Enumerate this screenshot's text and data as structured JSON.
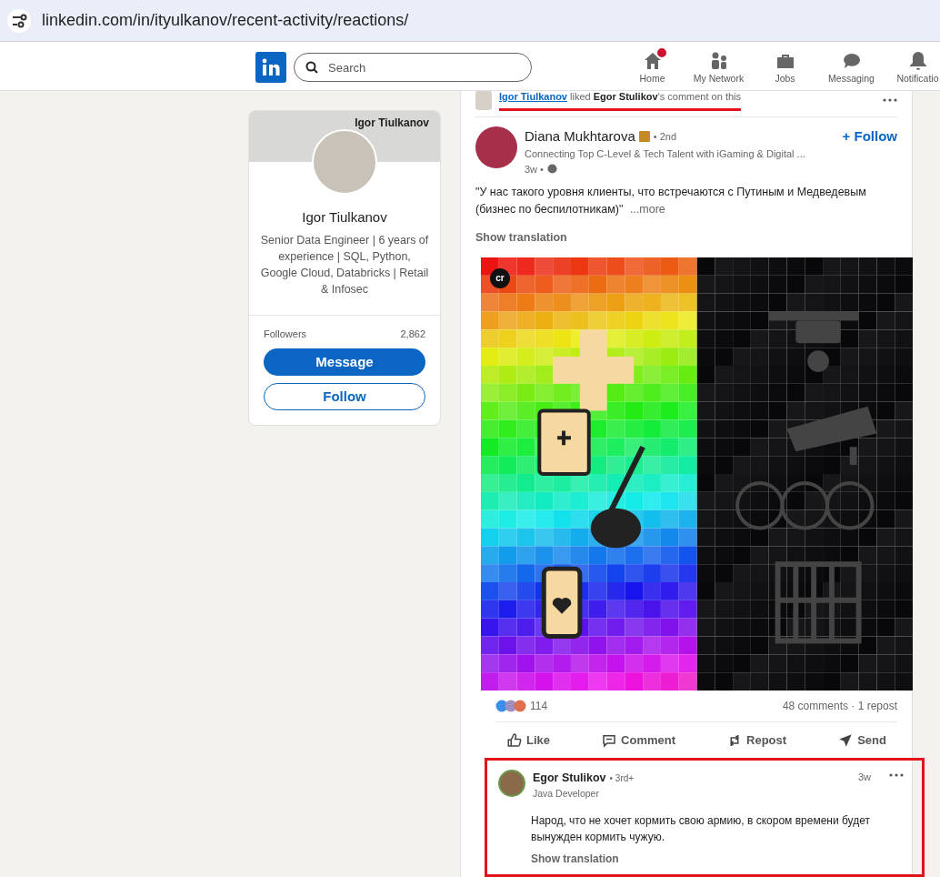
{
  "address_bar": {
    "url": "linkedin.com/in/ityulkanov/recent-activity/reactions/"
  },
  "nav": {
    "search_placeholder": "Search",
    "items": [
      {
        "label": "Home",
        "kind": "home",
        "badge": true
      },
      {
        "label": "My Network",
        "kind": "network",
        "badge": false
      },
      {
        "label": "Jobs",
        "kind": "jobs",
        "badge": false
      },
      {
        "label": "Messaging",
        "kind": "messaging",
        "badge": false
      },
      {
        "label": "Notificatio",
        "kind": "bell",
        "badge": false
      }
    ]
  },
  "profile_card": {
    "banner_title": "Igor Tiulkanov",
    "name": "Igor Tiulkanov",
    "headline": "Senior Data Engineer | 6 years of experience | SQL, Python, Google Cloud, Databricks | Retail & Infosec",
    "stat_label": "Followers",
    "stat_value": "2,862",
    "buttons": [
      {
        "label": "Message",
        "kind": "primary"
      },
      {
        "label": "Follow",
        "kind": "outline"
      }
    ]
  },
  "activity": {
    "actor": "Igor Tiulkanov",
    "verb": "liked",
    "target": "Egor Stulikov",
    "suffix": "'s comment on this",
    "underlined": true
  },
  "post": {
    "author": "Diana Mukhtarova",
    "degree": "• 2nd",
    "subtitle": "Connecting Top C-Level & Tech Talent with iGaming & Digital ...",
    "age": "3w •",
    "follow": "+ Follow",
    "text": "\"У нас такого уровня клиенты, что встречаются с Путиным и Медведевым (бизнес по беспилотникам)\"",
    "more": "...more",
    "translation": "Show translation",
    "image_badge": "cr",
    "reactions_count": "114",
    "stats": "48 comments · 1 repost",
    "actions": [
      {
        "label": "Like",
        "kind": "like"
      },
      {
        "label": "Comment",
        "kind": "comment"
      },
      {
        "label": "Repost",
        "kind": "repost"
      },
      {
        "label": "Send",
        "kind": "send"
      }
    ]
  },
  "comment": {
    "author": "Egor Stulikov",
    "degree": "• 3rd+",
    "headline": "Java Developer",
    "age": "3w",
    "text": "Народ, что не хочет кормить свою армию, в скором времени будет вынужден кормить чужую.",
    "translation": "Show translation",
    "highlighted": true
  }
}
